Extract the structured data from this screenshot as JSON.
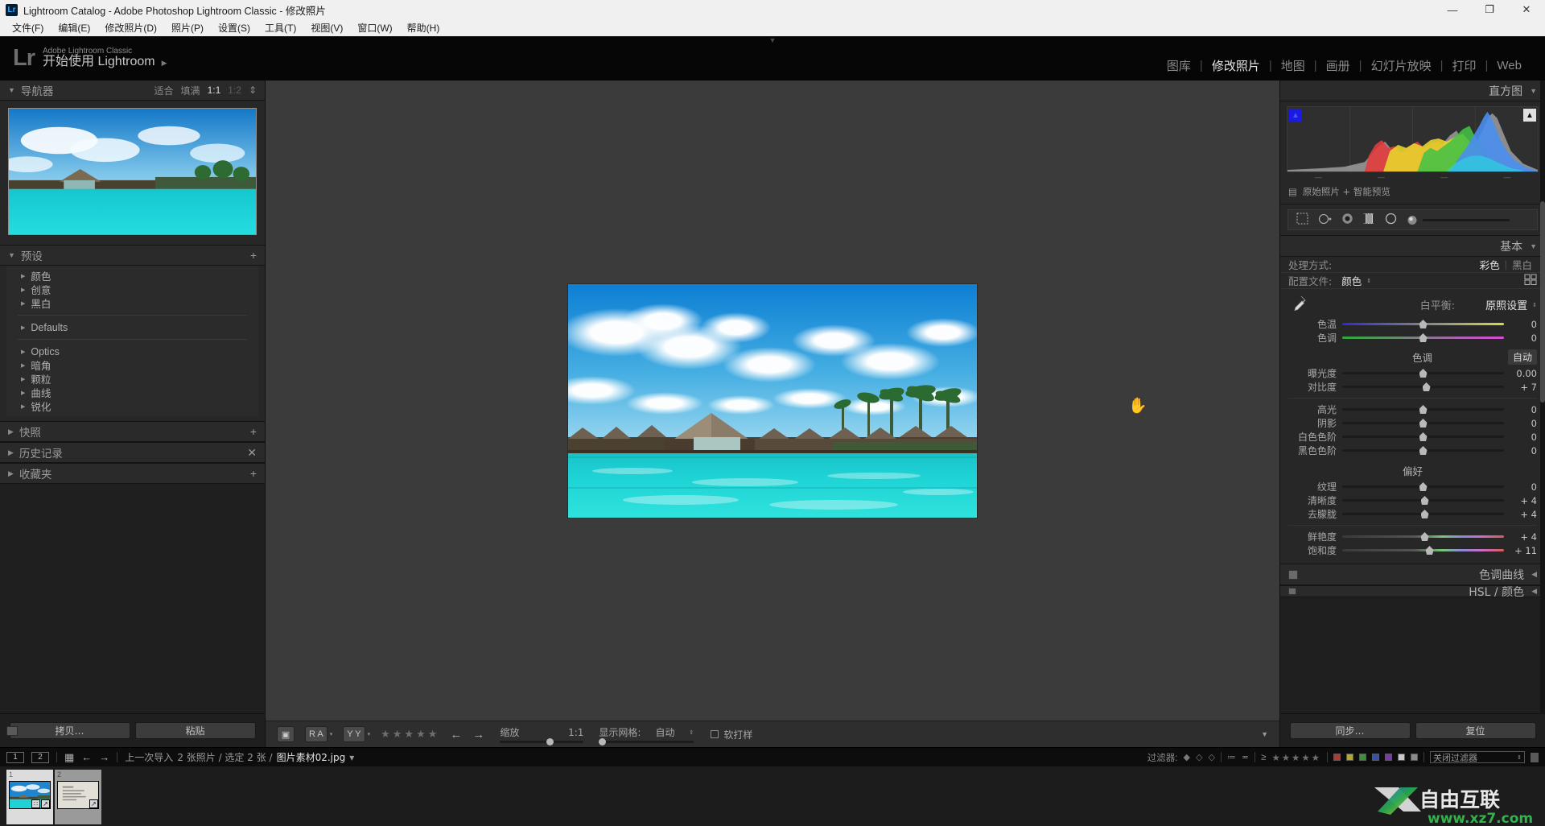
{
  "titlebar": {
    "logo": "Lr",
    "title": "Lightroom Catalog - Adobe Photoshop Lightroom Classic - 修改照片",
    "minimize": "—",
    "maximize": "❐",
    "close": "✕"
  },
  "menubar": {
    "items": [
      "文件(F)",
      "编辑(E)",
      "修改照片(D)",
      "照片(P)",
      "设置(S)",
      "工具(T)",
      "视图(V)",
      "窗口(W)",
      "帮助(H)"
    ]
  },
  "identity": {
    "logo": "Lr",
    "line1": "Adobe Lightroom Classic",
    "line2": "开始使用 Lightroom",
    "arrow": "▶"
  },
  "modules": {
    "items": [
      {
        "label": "图库",
        "active": false
      },
      {
        "label": "修改照片",
        "active": true
      },
      {
        "label": "地图",
        "active": false
      },
      {
        "label": "画册",
        "active": false
      },
      {
        "label": "幻灯片放映",
        "active": false
      },
      {
        "label": "打印",
        "active": false
      },
      {
        "label": "Web",
        "active": false
      }
    ],
    "separator": "|"
  },
  "left": {
    "navigator": {
      "title": "导航器",
      "triangle": "▼",
      "modes": [
        "适合",
        "填满",
        "1:1",
        "1:2"
      ],
      "stepper": "⇕"
    },
    "presets": {
      "title": "预设",
      "triangle": "▼",
      "add": "+",
      "groups": [
        {
          "label": "颜色",
          "divider_after": false
        },
        {
          "label": "创意",
          "divider_after": false
        },
        {
          "label": "黑白",
          "divider_after": true
        },
        {
          "label": "Defaults",
          "divider_after": true
        },
        {
          "label": "Optics",
          "divider_after": false
        },
        {
          "label": "暗角",
          "divider_after": false
        },
        {
          "label": "颗粒",
          "divider_after": false
        },
        {
          "label": "曲线",
          "divider_after": false
        },
        {
          "label": "锐化",
          "divider_after": false
        }
      ]
    },
    "panels": [
      {
        "title": "快照",
        "action": "+"
      },
      {
        "title": "历史记录",
        "action": "✕"
      },
      {
        "title": "收藏夹",
        "action": "+"
      }
    ],
    "buttons": {
      "copy": "拷贝…",
      "paste": "粘贴"
    }
  },
  "toolbar": {
    "view_icon": "▣",
    "ra_label": "R A",
    "yy_label": "Y Y",
    "caret": "▾",
    "stars": "★★★★★",
    "prev": "←",
    "next": "→",
    "zoom_label": "缩放",
    "zoom_value": "1:1",
    "grid_label": "显示网格:",
    "grid_value": "自动",
    "grid_stepper": "⇕",
    "softproof_label": "软打样",
    "collapse": "▼"
  },
  "right": {
    "histogram": {
      "title": "直方图",
      "triangle": "▼",
      "shadow_clip": "▲",
      "highlight_clip": "▲",
      "footer": "原始照片 + 智能预览",
      "footer_icon": "▤"
    },
    "tools": {
      "crop": "crop",
      "heal": "heal",
      "redeye": "redeye",
      "gradient": "gradient",
      "radial": "radial",
      "brush": "brush"
    },
    "basic": {
      "title": "基本",
      "triangle": "▼",
      "treatment_label": "处理方式:",
      "treatment_color": "彩色",
      "treatment_bw": "黑白",
      "profile_label": "配置文件:",
      "profile_value": "颜色",
      "profile_stepper": "⇕",
      "wb_label": "白平衡:",
      "wb_value": "原照设置",
      "wb_stepper": "⇕",
      "wb_sliders": [
        {
          "label": "色温",
          "value": "0",
          "pos": 50,
          "grad": "linear-gradient(90deg,#2b2bd0,#d8d84a)"
        },
        {
          "label": "色调",
          "value": "0",
          "pos": 50,
          "grad": "linear-gradient(90deg,#2fa83a,#d84ad8)"
        }
      ],
      "tone_title": "色调",
      "auto_label": "自动",
      "tone_sliders": [
        {
          "label": "曝光度",
          "value": "0.00",
          "pos": 50
        },
        {
          "label": "对比度",
          "value": "+ 7",
          "pos": 52
        }
      ],
      "tone_sliders2": [
        {
          "label": "高光",
          "value": "0",
          "pos": 50
        },
        {
          "label": "阴影",
          "value": "0",
          "pos": 50
        },
        {
          "label": "白色色阶",
          "value": "0",
          "pos": 50
        },
        {
          "label": "黑色色阶",
          "value": "0",
          "pos": 50
        }
      ],
      "presence_title": "偏好",
      "presence_sliders": [
        {
          "label": "纹理",
          "value": "0",
          "pos": 50
        },
        {
          "label": "清晰度",
          "value": "+ 4",
          "pos": 51
        },
        {
          "label": "去朦胧",
          "value": "+ 4",
          "pos": 51
        }
      ],
      "sat_sliders": [
        {
          "label": "鲜艳度",
          "value": "+ 4",
          "pos": 51,
          "grad": "linear-gradient(90deg,#4a4a4a 0%,#5a5a5a 45%,#7ac77a 60%,#8a8ad8 72%,#c86ec8 84%,#d85a5a 100%)"
        },
        {
          "label": "饱和度",
          "value": "+ 11",
          "pos": 54,
          "grad": "linear-gradient(90deg,#4a4a4a 0%,#5a5a5a 45%,#7ac77a 60%,#8a8ad8 72%,#c86ec8 84%,#d85a5a 100%)"
        }
      ]
    },
    "collapsed_panels": [
      {
        "title": "色调曲线",
        "triangle": "◀"
      },
      {
        "title": "HSL / 颜色",
        "triangle": "◀"
      }
    ],
    "buttons": {
      "sync": "同步…",
      "reset": "复位"
    }
  },
  "filmstrip": {
    "page1": "1",
    "page2": "2",
    "grid_icon": "∷",
    "prev": "←",
    "next": "→",
    "source": "上一次导入",
    "count": "2 张照片 / 选定 2 张 /",
    "filename": "图片素材02.jpg",
    "dropdown": "▾",
    "filter_label": "过滤器:",
    "flags": [
      "◆",
      "◇",
      "◇"
    ],
    "compare_icons": [
      "≔",
      "≖"
    ],
    "rating_op": "≥",
    "rating_stars": "★★★★★",
    "color_labels": [
      "#b03a3a",
      "#b0a832",
      "#3f8f3f",
      "#3a4fa8",
      "#7a3aa8",
      "#c8c8c8",
      "#8a8a8a"
    ],
    "filter_preset": "关闭过滤器",
    "filter_stepper": "⇕",
    "thumbs": [
      {
        "num": "1",
        "selected": true,
        "badges": [
          "∷",
          "↗"
        ]
      },
      {
        "num": "2",
        "selected": false,
        "badges": [
          "↗"
        ]
      }
    ]
  },
  "watermark": {
    "brand": "自由互联",
    "url": "www.xz7.com",
    "mark": "X"
  },
  "photo": {
    "alt": "maldives-overwater-bungalows-turquoise-lagoon"
  }
}
